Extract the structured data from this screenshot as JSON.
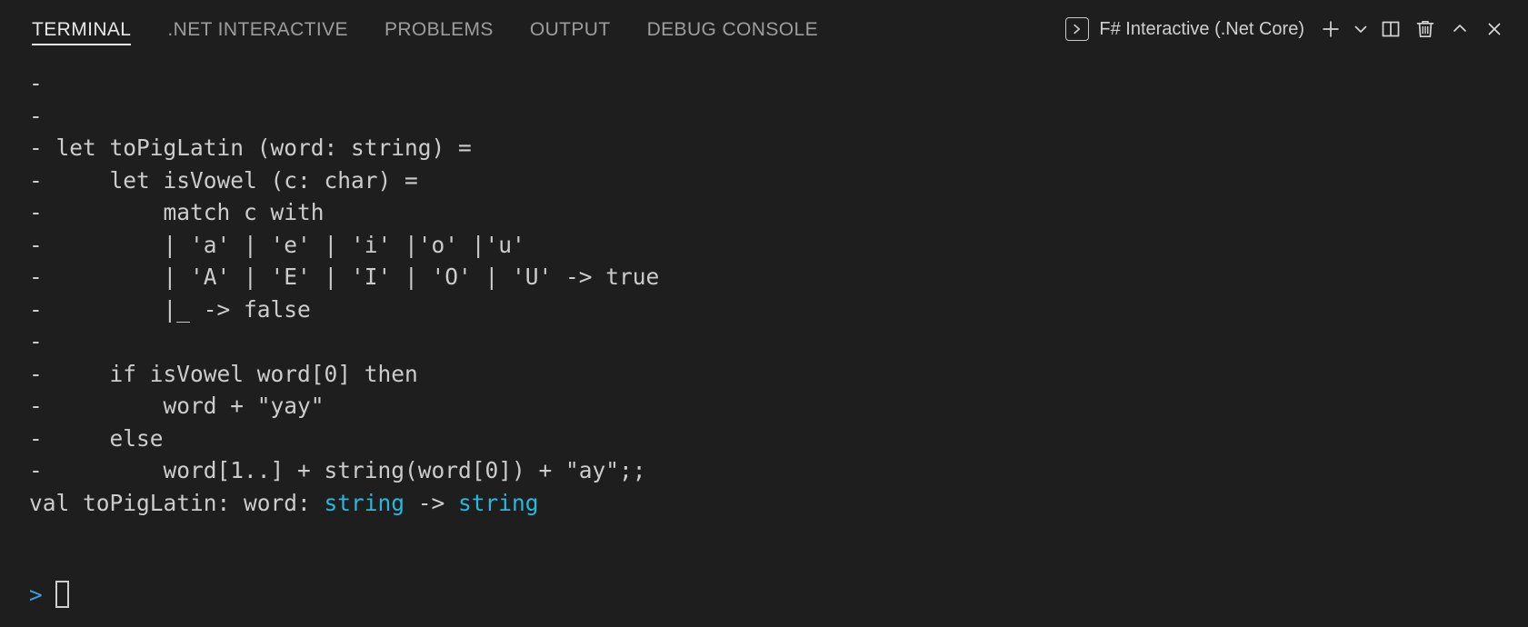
{
  "panel": {
    "tabs": [
      {
        "label": "TERMINAL",
        "active": true
      },
      {
        "label": ".NET INTERACTIVE",
        "active": false
      },
      {
        "label": "PROBLEMS",
        "active": false
      },
      {
        "label": "OUTPUT",
        "active": false
      },
      {
        "label": "DEBUG CONSOLE",
        "active": false
      }
    ],
    "terminal_selector": {
      "icon": "terminal-chevron-icon",
      "name": "F# Interactive (.Net Core)"
    },
    "actions": [
      {
        "name": "new-terminal-button",
        "icon": "plus-icon",
        "label": "+"
      },
      {
        "name": "terminal-profile-dropdown-button",
        "icon": "chevron-down-icon",
        "label": "⌄"
      },
      {
        "name": "split-terminal-button",
        "icon": "split-panel-icon",
        "label": ""
      },
      {
        "name": "kill-terminal-button",
        "icon": "trash-icon",
        "label": ""
      },
      {
        "name": "maximize-panel-button",
        "icon": "chevron-up-icon",
        "label": "⌃"
      },
      {
        "name": "close-panel-button",
        "icon": "close-icon",
        "label": "✕"
      }
    ]
  },
  "terminal": {
    "colors": {
      "background": "#1e1e1e",
      "foreground": "#cccccc",
      "type_keyword": "#29b8db",
      "prompt": "#3f9cd8",
      "tab_active": "#e7e7e7",
      "tab_inactive": "#9d9d9d"
    },
    "lines": [
      {
        "segments": [
          {
            "text": "- ",
            "style": "cont"
          }
        ]
      },
      {
        "segments": [
          {
            "text": "- ",
            "style": "cont"
          }
        ]
      },
      {
        "segments": [
          {
            "text": "- let toPigLatin (word: string) =",
            "style": "plain"
          }
        ]
      },
      {
        "segments": [
          {
            "text": "-     let isVowel (c: char) =",
            "style": "plain"
          }
        ]
      },
      {
        "segments": [
          {
            "text": "-         match c with",
            "style": "plain"
          }
        ]
      },
      {
        "segments": [
          {
            "text": "-         | 'a' | 'e' | 'i' |'o' |'u'",
            "style": "plain"
          }
        ]
      },
      {
        "segments": [
          {
            "text": "-         | 'A' | 'E' | 'I' | 'O' | 'U' -> true",
            "style": "plain"
          }
        ]
      },
      {
        "segments": [
          {
            "text": "-         |_ -> false",
            "style": "plain"
          }
        ]
      },
      {
        "segments": [
          {
            "text": "- ",
            "style": "cont"
          }
        ]
      },
      {
        "segments": [
          {
            "text": "-     if isVowel word[0] then",
            "style": "plain"
          }
        ]
      },
      {
        "segments": [
          {
            "text": "-         word + \"yay\"",
            "style": "plain"
          }
        ]
      },
      {
        "segments": [
          {
            "text": "-     else",
            "style": "plain"
          }
        ]
      },
      {
        "segments": [
          {
            "text": "-         word[1..] + string(word[0]) + \"ay\";;",
            "style": "plain"
          }
        ]
      },
      {
        "segments": [
          {
            "text": "val toPigLatin: word: ",
            "style": "plain"
          },
          {
            "text": "string",
            "style": "type"
          },
          {
            "text": " -> ",
            "style": "plain"
          },
          {
            "text": "string",
            "style": "type"
          }
        ]
      },
      {
        "segments": [
          {
            "text": "",
            "style": "plain"
          }
        ]
      }
    ],
    "prompt": {
      "symbol": ">",
      "input_value": "",
      "cursor": "block-outline"
    }
  }
}
